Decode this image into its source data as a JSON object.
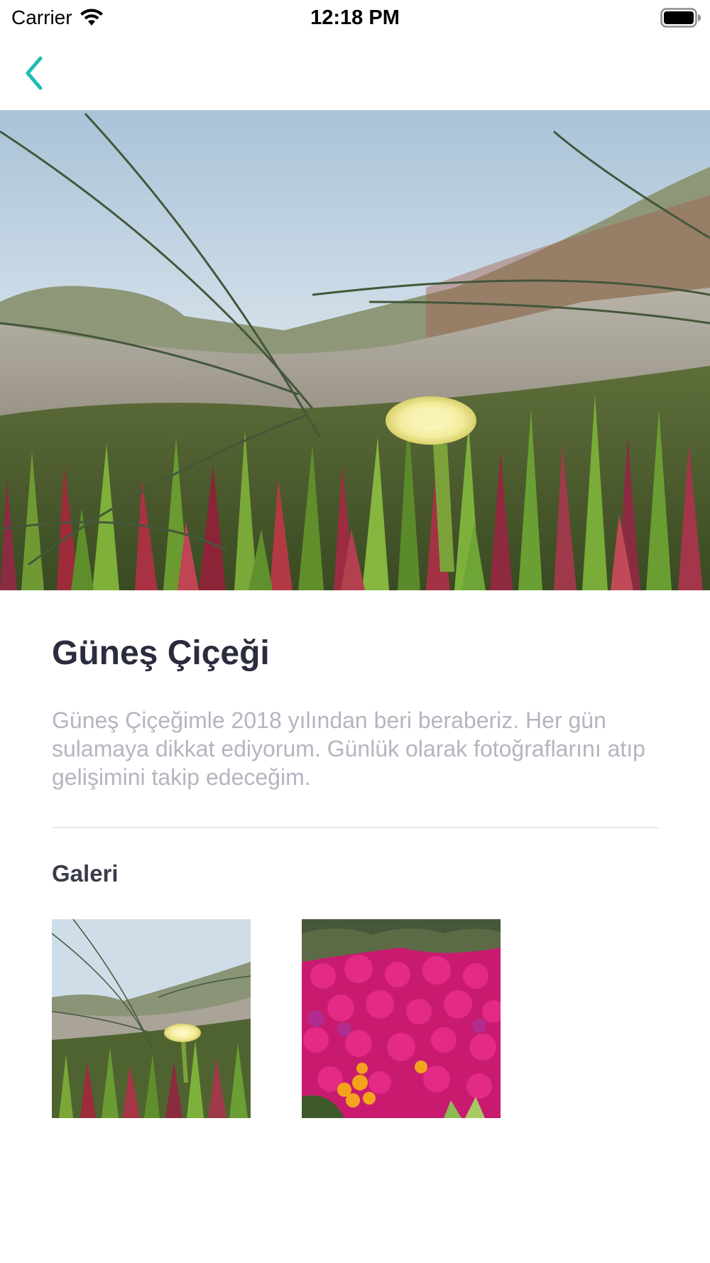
{
  "status_bar": {
    "carrier": "Carrier",
    "time": "12:18 PM",
    "icons": [
      "wifi-icon",
      "battery-icon"
    ]
  },
  "nav": {
    "back_icon": "chevron-left-icon",
    "accent_color": "#1bbcb4"
  },
  "hero_image": {
    "description_icon": "flower-photo"
  },
  "plant": {
    "title": "Güneş Çiçeği",
    "description": "Güneş Çiçeğimle 2018 yılından beri beraberiz. Her gün sulamaya dikkat ediyorum. Günlük olarak fotoğraflarını atıp gelişimini takip edeceğim."
  },
  "gallery": {
    "title": "Galeri",
    "items": [
      "gallery-photo-1",
      "gallery-photo-2"
    ]
  },
  "colors": {
    "title": "#2b2d3e",
    "description": "#b3b6c0",
    "divider": "#e6e7ea"
  }
}
